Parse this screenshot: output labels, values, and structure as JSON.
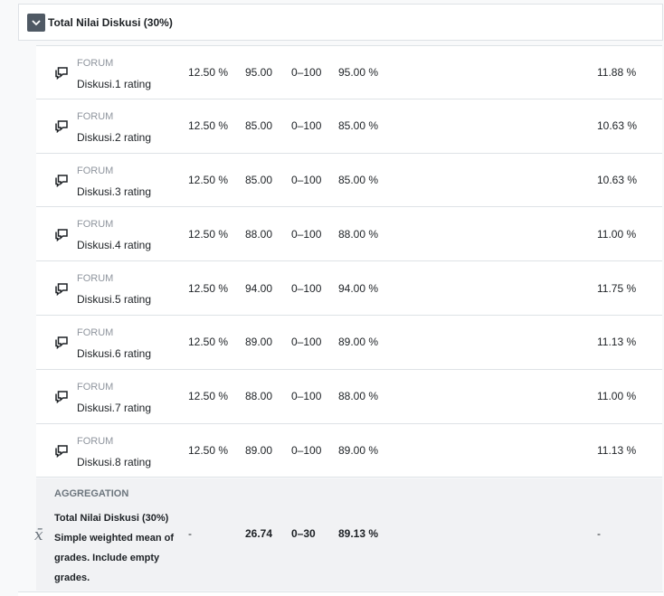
{
  "category": {
    "title": "Total Nilai Diskusi (30%)"
  },
  "items": [
    {
      "type": "FORUM",
      "name": "Diskusi.1 rating",
      "weight": "12.50 %",
      "grade": "95.00",
      "range": "0–100",
      "percentage": "95.00 %",
      "contribution": "11.88 %"
    },
    {
      "type": "FORUM",
      "name": "Diskusi.2 rating",
      "weight": "12.50 %",
      "grade": "85.00",
      "range": "0–100",
      "percentage": "85.00 %",
      "contribution": "10.63 %"
    },
    {
      "type": "FORUM",
      "name": "Diskusi.3 rating",
      "weight": "12.50 %",
      "grade": "85.00",
      "range": "0–100",
      "percentage": "85.00 %",
      "contribution": "10.63 %"
    },
    {
      "type": "FORUM",
      "name": "Diskusi.4 rating",
      "weight": "12.50 %",
      "grade": "88.00",
      "range": "0–100",
      "percentage": "88.00 %",
      "contribution": "11.00 %"
    },
    {
      "type": "FORUM",
      "name": "Diskusi.5 rating",
      "weight": "12.50 %",
      "grade": "94.00",
      "range": "0–100",
      "percentage": "94.00 %",
      "contribution": "11.75 %"
    },
    {
      "type": "FORUM",
      "name": "Diskusi.6 rating",
      "weight": "12.50 %",
      "grade": "89.00",
      "range": "0–100",
      "percentage": "89.00 %",
      "contribution": "11.13 %"
    },
    {
      "type": "FORUM",
      "name": "Diskusi.7 rating",
      "weight": "12.50 %",
      "grade": "88.00",
      "range": "0–100",
      "percentage": "88.00 %",
      "contribution": "11.00 %"
    },
    {
      "type": "FORUM",
      "name": "Diskusi.8 rating",
      "weight": "12.50 %",
      "grade": "89.00",
      "range": "0–100",
      "percentage": "89.00 %",
      "contribution": "11.13 %"
    }
  ],
  "aggregation": {
    "type": "AGGREGATION",
    "name": "Total Nilai Diskusi (30%) Simple weighted mean of grades. Include empty grades.",
    "weight": "-",
    "grade": "26.74",
    "range": "0–30",
    "percentage": "89.13 %",
    "contribution": "-"
  },
  "icons": {
    "toggle": "chevron-down-icon",
    "item": "forum-icon",
    "aggregation": "mean-icon"
  },
  "colors": {
    "toggle_bg": "#4f5964",
    "muted_text": "#8f959e",
    "aggregation_bg": "#f1f2f4"
  }
}
